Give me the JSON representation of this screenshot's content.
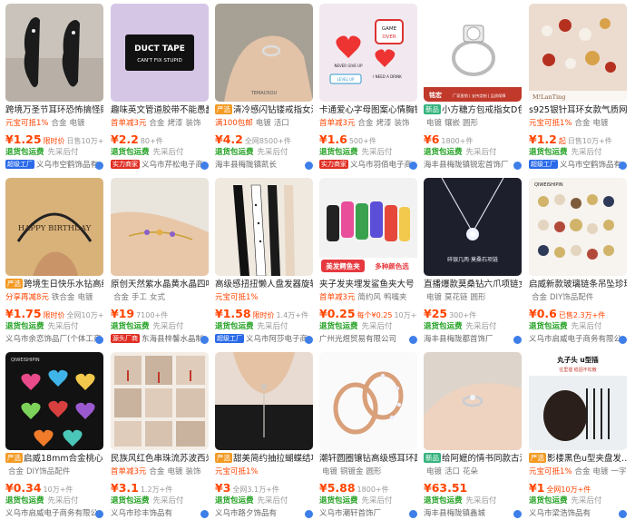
{
  "colors": {
    "price": "#ff4400",
    "service": "#20a020",
    "badge_yan": "#f39a23",
    "badge_new": "#36b37e",
    "seller_factory": "#2a6ae9",
    "seller_real": "#e02e24"
  },
  "products": [
    {
      "title": "跨境万圣节耳环恐怖搞怪貼",
      "promo": "元宝可抵1%",
      "tags": [
        "合金",
        "电镀"
      ],
      "price": "¥1.25",
      "price_sub": "限时价",
      "sold": "日售10万+件",
      "service": "退货包运费",
      "service2": "先采后付",
      "seller_badge": "超级工厂",
      "seller": "义乌市空鹤饰品有",
      "image_icon": "bat-earrings-icon"
    },
    {
      "title": "趣味英文管道胶带不能愚蠢",
      "promo": "首单减3元",
      "tags": [
        "合金",
        "烤漆",
        "装饰"
      ],
      "price": "¥2.2",
      "price_sub": "",
      "sold": "80+件",
      "service": "退货包运费",
      "service2": "先采后付",
      "seller_badge": "实力商家",
      "seller": "义乌市芹松电子商",
      "image_icon": "duct-tape-pin-icon",
      "image_text": [
        "DUCT TAPE",
        "CAN'T FIX STUPID"
      ]
    },
    {
      "title": "清冷感闪钻镂戒指女温",
      "title_badge": "严选",
      "promo": "满100包邮",
      "tags": [
        "电镀",
        "活口"
      ],
      "price": "¥4.2",
      "price_sub": "",
      "sold": "全网8500+件",
      "service": "退货包运费",
      "service2": "先采后付",
      "seller_badge": "",
      "seller": "海丰县梅陇镇凯长",
      "image_icon": "ring-on-hand-icon",
      "image_text": [
        "TEMACROU"
      ]
    },
    {
      "title": "卡通爱心字母图案心情胸针",
      "promo": "首单减3元",
      "tags": [
        "合金",
        "烤漆",
        "装饰"
      ],
      "price": "¥1.6",
      "price_sub": "",
      "sold": "500+件",
      "service": "退货包运费",
      "service2": "先采后付",
      "seller_badge": "实力商家",
      "seller": "义乌市羽佰电子商",
      "image_icon": "heart-pins-icon",
      "image_text": [
        "GAME",
        "OVER",
        "NEVER GIVE UP",
        "LEVEL UP",
        "I NEED A DRINK"
      ]
    },
    {
      "title": "小方糖方包戒指女D色",
      "title_badge": "新品",
      "promo": "",
      "tags": [
        "电镀",
        "镶嵌",
        "圆形"
      ],
      "price": "¥6",
      "price_sub": "",
      "sold": "1800+件",
      "service": "退货包运费",
      "service2": "先采后付",
      "seller_badge": "",
      "seller": "海丰县梅陇镇锐宏首饰厂",
      "image_icon": "diamond-ring-icon",
      "image_text": [
        "铭宏",
        "厂家直销 | 支持定制 | 品质保障"
      ]
    },
    {
      "title": "s925银针耳环女款气质网红",
      "promo": "元宝可抵1%",
      "tags": [
        "合金",
        "电镀"
      ],
      "price": "¥1.2",
      "price_sub": "起",
      "sold": "日售10万+件",
      "service": "退货包运费",
      "service2": "先采后付",
      "seller_badge": "超级工厂",
      "seller": "义乌市空鹤饰品有",
      "image_icon": "pearl-earrings-icon",
      "image_text": [
        "M!LanTing"
      ]
    },
    {
      "title": "跨境生日快乐水钻高级",
      "title_badge": "严选",
      "promo": "分享再减8元",
      "tags": [
        "铁合金",
        "电镀"
      ],
      "price": "¥1.75",
      "price_sub": "限时价",
      "sold": "全网10万+件",
      "service": "退货包运费",
      "service2": "先采后付",
      "seller_badge": "",
      "seller": "义乌市余恋饰品厂(个体工商",
      "image_icon": "birthday-headband-icon",
      "image_text": [
        "HAPPY BIRTHDAY"
      ]
    },
    {
      "title": "原创天然紫水晶黄水晶四叶",
      "promo": "",
      "tags": [
        "合金",
        "手工",
        "女式"
      ],
      "price": "¥19",
      "price_sub": "",
      "sold": "7100+件",
      "service": "退货包运费",
      "service2": "先采后付",
      "seller_badge": "源头厂商",
      "seller": "东海县梓馨水晶制",
      "image_icon": "crystal-bracelet-icon"
    },
    {
      "title": "高级感扭扭懒人盘发器旋转",
      "promo": "元宝可抵1%",
      "tags": [],
      "price": "¥1.58",
      "price_sub": "限时价",
      "sold": "1.4万+件",
      "service": "退货包运费",
      "service2": "先采后付",
      "seller_badge": "超级工厂",
      "seller": "义乌市阿莎电子商",
      "image_icon": "hair-twister-icon"
    },
    {
      "title": "夹子发夹埋发鲨鱼夹大号",
      "promo": "首单减3元",
      "tags": [
        "简约风",
        "鸭嘴夹"
      ],
      "price": "¥0.25",
      "price_sub": "每个¥0.25",
      "sold": "10万+件",
      "service": "退货包运费",
      "service2": "先采后付",
      "seller_badge": "",
      "seller": "广州光煜贸易有限公司",
      "image_icon": "hair-claw-icon",
      "image_text": [
        "美发鳄鱼夹",
        "多种颜色选"
      ]
    },
    {
      "title": "直播爆款莫桑钻六爪项链女",
      "promo": "",
      "tags": [
        "电镀",
        "莫花链",
        "圆形"
      ],
      "price": "¥25",
      "price_sub": "",
      "sold": "300+件",
      "service": "退货包运费",
      "service2": "先采后付",
      "seller_badge": "",
      "seller": "海丰县梅陇都首饰厂",
      "image_icon": "pendant-necklace-icon",
      "image_text": [
        "碎银几两·莫桑石项链"
      ]
    },
    {
      "title": "启威新款玻璃链条吊坠珍珠",
      "promo": "",
      "tags": [
        "合金",
        "DIY饰品配件"
      ],
      "price": "¥0.6",
      "price_sub": "已售2.3万+件",
      "sold": "",
      "service": "退货包运费",
      "service2": "先采后付",
      "seller_badge": "",
      "seller": "义乌市启威电子商务有限公",
      "image_icon": "pendants-assortment-icon",
      "image_text": [
        "QIWEISHIPIN"
      ]
    },
    {
      "title": "启威18mm合金桃心吊坠",
      "title_badge": "严选",
      "promo": "",
      "tags": [
        "合金",
        "DIY饰品配件"
      ],
      "price": "¥0.34",
      "price_sub": "",
      "sold": "10万+件",
      "service": "退货包运费",
      "service2": "先采后付",
      "seller_badge": "",
      "seller": "义乌市启威电子商务有限公",
      "image_icon": "heart-pendants-icon",
      "image_text": [
        "QIWEISHIPIN"
      ]
    },
    {
      "title": "民族风红色串珠流苏波西米",
      "promo": "首单减3元",
      "tags": [
        "合金",
        "电镀",
        "装饰"
      ],
      "price": "¥3.1",
      "price_sub": "",
      "sold": "1.2万+件",
      "service": "退货包运费",
      "service2": "先采后付",
      "seller_badge": "",
      "seller": "义乌市珍丰饰品有",
      "image_icon": "tassel-earrings-icon"
    },
    {
      "title": "甜美简约抽拉蝴蝶结项",
      "title_badge": "严选",
      "promo": "元宝可抵1%",
      "tags": [],
      "price": "¥3",
      "price_sub": "",
      "sold": "全网3.1万+件",
      "service": "退货包运费",
      "service2": "先采后付",
      "seller_badge": "",
      "seller": "义乌市路夕饰品有",
      "image_icon": "bow-necklace-icon"
    },
    {
      "title": "潮轩圆圈镶钻高级感耳环跨",
      "promo": "",
      "tags": [
        "电镀",
        "铜镀金",
        "圆形"
      ],
      "price": "¥5.88",
      "price_sub": "",
      "sold": "1800+件",
      "service": "退货包运费",
      "service2": "先采后付",
      "seller_badge": "",
      "seller": "义乌市潮轩首饰厂",
      "image_icon": "hoop-earrings-icon"
    },
    {
      "title": "给阿嬷的情书同款古法",
      "title_badge": "新品",
      "promo": "",
      "tags": [
        "电镀",
        "活口",
        "花朵"
      ],
      "price": "¥63.51",
      "price_sub": "",
      "sold": "",
      "service": "退货包运费",
      "service2": "先采后付",
      "seller_badge": "",
      "seller": "海丰县梅陇镇鑫城",
      "image_icon": "flower-ring-icon"
    },
    {
      "title": "影楼黑色u型夹盘发…",
      "title_badge": "严选",
      "promo": "元宝可抵1%",
      "tags": [
        "合金",
        "电镀",
        "一字"
      ],
      "price": "¥1",
      "price_sub": "全网10万+件",
      "sold": "",
      "service": "退货包运费",
      "service2": "先采后付",
      "seller_badge": "",
      "seller": "义乌市梁浩饰品有",
      "image_icon": "u-hairpin-icon",
      "image_text": [
        "丸子头 u型插",
        "往里插 稳固不松散"
      ]
    }
  ]
}
